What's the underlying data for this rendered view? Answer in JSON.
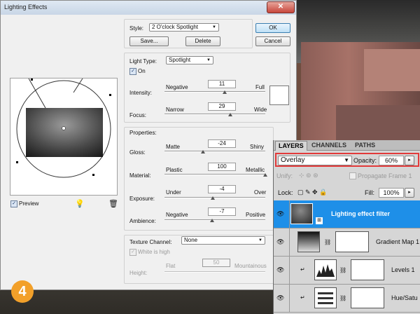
{
  "window": {
    "title": "Lighting Effects"
  },
  "style": {
    "label": "Style:",
    "value": "2 O'clock Spotlight",
    "save": "Save...",
    "delete": "Delete",
    "ok": "OK",
    "cancel": "Cancel"
  },
  "light": {
    "type_label": "Light Type:",
    "type_value": "Spotlight",
    "on_label": "On",
    "intensity": {
      "label": "Intensity:",
      "min": "Negative",
      "max": "Full",
      "value": "11",
      "level": 0.6
    },
    "focus": {
      "label": "Focus:",
      "min": "Narrow",
      "max": "Wide",
      "value": "29",
      "level": 0.65
    }
  },
  "properties": {
    "title": "Properties:",
    "gloss": {
      "label": "Gloss:",
      "min": "Matte",
      "max": "Shiny",
      "value": "-24",
      "level": 0.38
    },
    "material": {
      "label": "Material:",
      "min": "Plastic",
      "max": "Metallic",
      "value": "100",
      "level": 1.0
    },
    "exposure": {
      "label": "Exposure:",
      "min": "Under",
      "max": "Over",
      "value": "-4",
      "level": 0.48
    },
    "ambience": {
      "label": "Ambience:",
      "min": "Negative",
      "max": "Positive",
      "value": "-7",
      "level": 0.47
    }
  },
  "texture": {
    "title": "Texture Channel:",
    "value": "None",
    "white_label": "White is high",
    "height": {
      "label": "Height:",
      "min": "Flat",
      "max": "Mountainous",
      "value": "50"
    }
  },
  "preview_label": "Preview",
  "layers_panel": {
    "tabs": [
      "LAYERS",
      "CHANNELS",
      "PATHS"
    ],
    "blend_mode": "Overlay",
    "opacity_label": "Opacity:",
    "opacity_value": "60%",
    "unify_label": "Unify:",
    "propagate_label": "Propagate Frame 1",
    "lock_label": "Lock:",
    "fill_label": "Fill:",
    "fill_value": "100%",
    "layers": [
      {
        "name": "Lighting effect filter",
        "selected": true
      },
      {
        "name": "Gradient Map 1",
        "selected": false
      },
      {
        "name": "Levels 1",
        "selected": false
      },
      {
        "name": "Hue/Satu",
        "selected": false
      }
    ]
  },
  "step_badge": "4",
  "colors": {
    "accent": "#1e8fe8",
    "badge": "#f2a02a",
    "highlight": "#e23a3a"
  }
}
